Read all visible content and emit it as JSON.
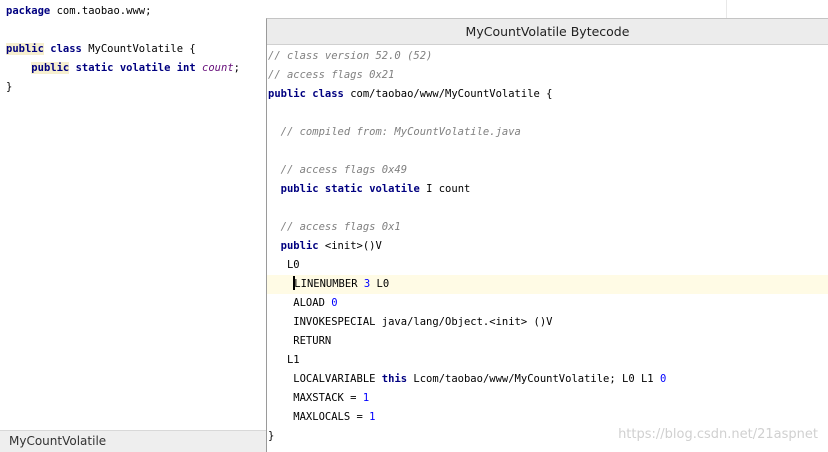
{
  "editor": {
    "lines": [
      {
        "parts": [
          {
            "t": "package",
            "c": "kw"
          },
          {
            "t": " com.taobao.www;"
          }
        ]
      },
      {
        "parts": []
      },
      {
        "parts": [
          {
            "t": "public",
            "c": "kw hl-word"
          },
          {
            "t": " "
          },
          {
            "t": "class",
            "c": "kw"
          },
          {
            "t": " MyCountVolatile {"
          }
        ]
      },
      {
        "parts": [
          {
            "t": "    "
          },
          {
            "t": "public",
            "c": "kw hl-word"
          },
          {
            "t": " "
          },
          {
            "t": "static",
            "c": "kw"
          },
          {
            "t": " "
          },
          {
            "t": "volatile",
            "c": "kw"
          },
          {
            "t": " "
          },
          {
            "t": "int",
            "c": "kw"
          },
          {
            "t": " "
          },
          {
            "t": "count",
            "c": "fld"
          },
          {
            "t": ";"
          }
        ]
      },
      {
        "parts": [
          {
            "t": "}"
          }
        ]
      }
    ]
  },
  "tab": {
    "label": "MyCountVolatile"
  },
  "popup": {
    "title": "MyCountVolatile Bytecode",
    "lines": [
      {
        "style": "cmt",
        "parts": [
          {
            "t": "// class version 52.0 (52)"
          }
        ]
      },
      {
        "style": "cmt",
        "parts": [
          {
            "t": "// access flags 0x21"
          }
        ]
      },
      {
        "parts": [
          {
            "t": "public",
            "c": "kw"
          },
          {
            "t": " "
          },
          {
            "t": "class",
            "c": "kw"
          },
          {
            "t": " com/taobao/www/MyCountVolatile {"
          }
        ]
      },
      {
        "parts": []
      },
      {
        "style": "cmt",
        "parts": [
          {
            "t": "  // compiled from: MyCountVolatile.java"
          }
        ]
      },
      {
        "parts": []
      },
      {
        "style": "cmt",
        "parts": [
          {
            "t": "  // access flags 0x49"
          }
        ]
      },
      {
        "parts": [
          {
            "t": "  "
          },
          {
            "t": "public",
            "c": "kw"
          },
          {
            "t": " "
          },
          {
            "t": "static",
            "c": "kw"
          },
          {
            "t": " "
          },
          {
            "t": "volatile",
            "c": "kw"
          },
          {
            "t": " I count"
          }
        ]
      },
      {
        "parts": []
      },
      {
        "style": "cmt",
        "parts": [
          {
            "t": "  // access flags 0x1"
          }
        ]
      },
      {
        "parts": [
          {
            "t": "  "
          },
          {
            "t": "public",
            "c": "kw"
          },
          {
            "t": " <init>()V"
          }
        ]
      },
      {
        "parts": [
          {
            "t": "   L0"
          }
        ]
      },
      {
        "style": "current",
        "parts": [
          {
            "t": "    "
          },
          {
            "t": "",
            "c": "caret"
          },
          {
            "t": "LINENUMBER "
          },
          {
            "t": "3",
            "c": "num"
          },
          {
            "t": " L0"
          }
        ]
      },
      {
        "parts": [
          {
            "t": "    ALOAD "
          },
          {
            "t": "0",
            "c": "num"
          }
        ]
      },
      {
        "parts": [
          {
            "t": "    INVOKESPECIAL java/lang/Object.<init> ()V"
          }
        ]
      },
      {
        "parts": [
          {
            "t": "    RETURN"
          }
        ]
      },
      {
        "parts": [
          {
            "t": "   L1"
          }
        ]
      },
      {
        "parts": [
          {
            "t": "    LOCALVARIABLE "
          },
          {
            "t": "this",
            "c": "kw"
          },
          {
            "t": " Lcom/taobao/www/MyCountVolatile; L0 L1 "
          },
          {
            "t": "0",
            "c": "num"
          }
        ]
      },
      {
        "parts": [
          {
            "t": "    MAXSTACK = "
          },
          {
            "t": "1",
            "c": "num"
          }
        ]
      },
      {
        "parts": [
          {
            "t": "    MAXLOCALS = "
          },
          {
            "t": "1",
            "c": "num"
          }
        ]
      },
      {
        "parts": [
          {
            "t": "}"
          }
        ]
      }
    ]
  },
  "watermark": "https://blog.csdn.net/21aspnet",
  "colors": {
    "keyword": "#000080",
    "comment": "#808080",
    "number": "#0000ff",
    "field": "#660e7a",
    "caret_row": "#fffbe5"
  }
}
